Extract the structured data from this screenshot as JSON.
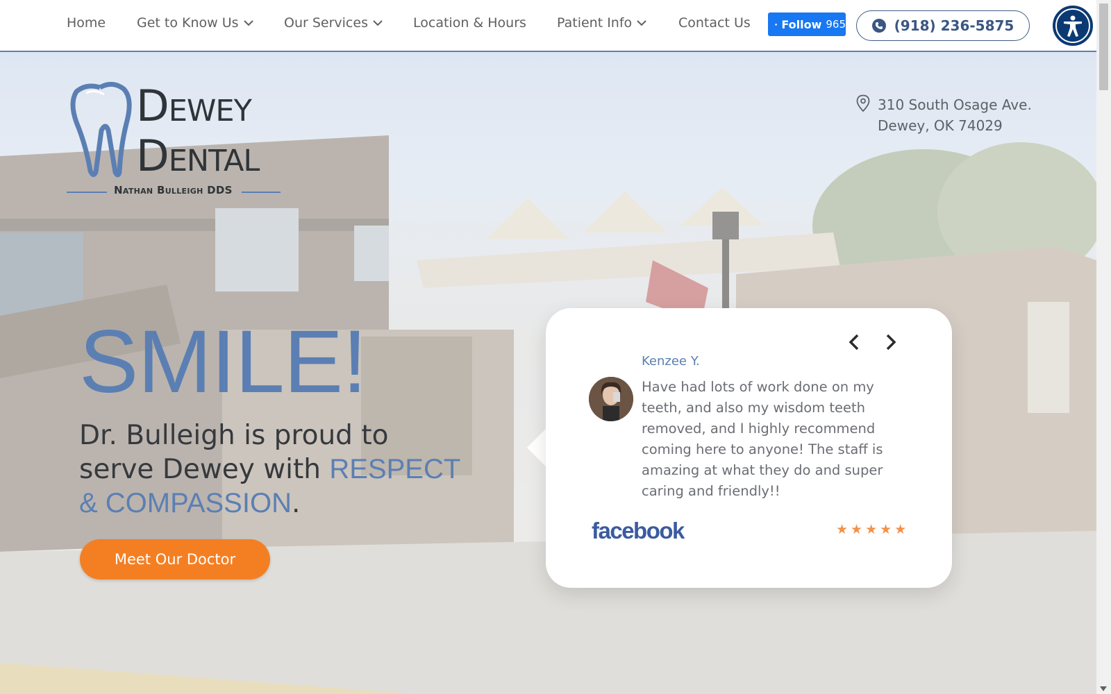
{
  "nav": {
    "items": [
      {
        "label": "Home",
        "dropdown": false
      },
      {
        "label": "Get to Know Us",
        "dropdown": true
      },
      {
        "label": "Our Services",
        "dropdown": true
      },
      {
        "label": "Location & Hours",
        "dropdown": false
      },
      {
        "label": "Patient Info",
        "dropdown": true
      },
      {
        "label": "Contact Us",
        "dropdown": false
      }
    ],
    "facebook_follow": {
      "label": "Follow",
      "count": "965"
    },
    "phone": "(918) 236-5875",
    "accessibility_icon": "accessibility-icon"
  },
  "logo": {
    "line1": "Dewey",
    "line2": "Dental",
    "subtitle": "Nathan Bulleigh DDS"
  },
  "address": {
    "line1": "310 South Osage Ave.",
    "line2": "Dewey, OK 74029"
  },
  "hero": {
    "headline": "SMILE!",
    "tagline_prefix": "Dr. Bulleigh is proud to serve Dewey with",
    "tagline_accent": "RESPECT & COMPASSION",
    "tagline_suffix": ".",
    "cta": "Meet Our Doctor"
  },
  "review": {
    "name": "Kenzee Y.",
    "text": "Have had lots of work done on my teeth, and also my wisdom teeth removed, and I highly recommend coming here to anyone! The staff is amazing at what they do and super caring and friendly!!",
    "source": "facebook",
    "rating": 5,
    "stars": [
      "★",
      "★",
      "★",
      "★",
      "★"
    ]
  },
  "colors": {
    "brand_blue": "#5b7fb3",
    "cta_orange": "#f47f23",
    "facebook_blue": "#1877f2",
    "star_orange": "#f2924a"
  }
}
